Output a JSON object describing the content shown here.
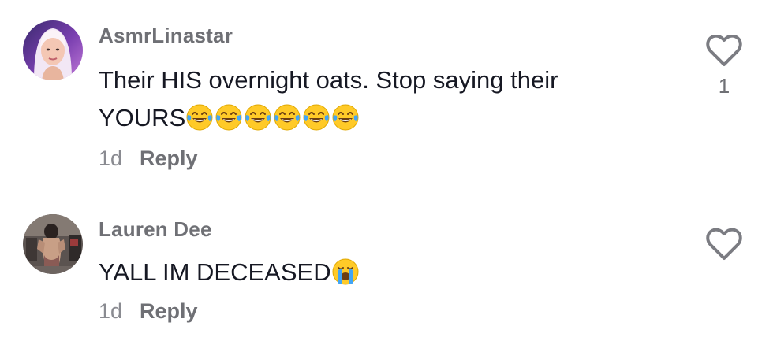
{
  "comments": [
    {
      "username": "AsmrLinastar",
      "text": "Their HIS overnight oats. Stop saying their",
      "text_line2": "YOURS",
      "emoji": "face-with-tears-of-joy",
      "emoji_count": 6,
      "time": "1d",
      "reply_label": "Reply",
      "like_icon": "heart-outline-icon",
      "like_count": "1"
    },
    {
      "username": "Lauren Dee",
      "text": "YALL IM DECEASED",
      "emoji": "loudly-crying-face",
      "emoji_count": 1,
      "time": "1d",
      "reply_label": "Reply",
      "like_icon": "heart-outline-icon",
      "like_count": ""
    }
  ],
  "colors": {
    "text": "#161823",
    "username": "#6f7075",
    "meta": "#8a8b91",
    "emoji_face": "#ffca28",
    "tears": "#42a5f5"
  }
}
